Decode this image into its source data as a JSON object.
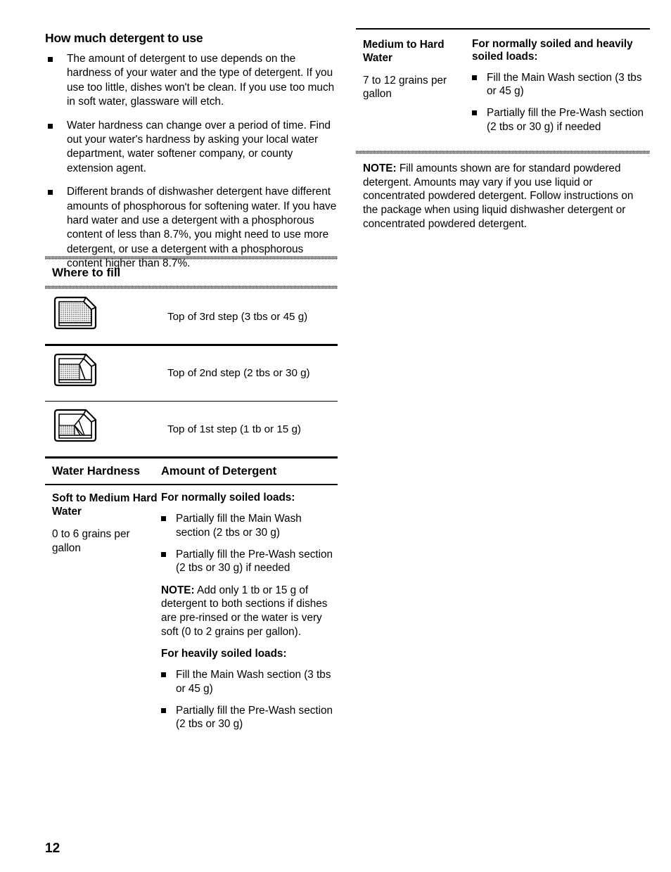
{
  "page": {
    "number": "12"
  },
  "left_column": {
    "heading": "How much detergent to use",
    "bullets": [
      "The amount of detergent to use depends on the hardness of your water and the type of detergent. If you use too little, dishes won't be clean. If you use too much in soft water, glassware will etch.",
      "Water hardness can change over a period of time. Find out your water's hardness by asking your local water department, water softener company, or county extension agent.",
      "Different brands of dishwasher detergent have different amounts of phosphorous for softening water. If you have hard water and use a detergent with a phosphorous content of less than 8.7%, you might need to use more detergent, or use a detergent with a phosphorous content higher than 8.7%."
    ]
  },
  "where_to_fill": {
    "heading": "Where to fill",
    "rows": [
      {
        "icon": "detergent-cup-full-icon",
        "label": "Top of 3rd step (3 tbs or 45 g)"
      },
      {
        "icon": "detergent-cup-two-thirds-icon",
        "label": "Top of 2nd step (2 tbs or 30 g)"
      },
      {
        "icon": "detergent-cup-one-third-icon",
        "label": "Top of 1st step (1 tb or 15 g)"
      }
    ]
  },
  "hardness_table": {
    "header": {
      "col1": "Water Hardness",
      "col2": "Amount of Detergent"
    },
    "soft_row": {
      "hardness_name": "Soft to Medium Hard Water",
      "hardness_range": "0 to 6 grains per gallon",
      "normal_heading": "For normally soiled loads:",
      "normal_bullets": [
        "Partially fill the Main Wash section (2 tbs or 30 g)",
        "Partially fill the Pre-Wash section (2 tbs or 30 g) if needed"
      ],
      "note_label": "NOTE:",
      "note_text": " Add only 1 tb or 15 g of detergent to both sections if dishes are pre-rinsed or the water is very soft (0 to 2 grains per gallon).",
      "heavy_heading": "For heavily soiled loads:",
      "heavy_bullets": [
        "Fill the Main Wash section (3 tbs or 45 g)",
        "Partially fill the Pre-Wash section (2 tbs or 30 g)"
      ]
    },
    "hard_row": {
      "hardness_name": "Medium to Hard Water",
      "hardness_range": "7 to 12 grains per gallon",
      "loads_heading": "For normally soiled and heavily soiled loads:",
      "bullets": [
        "Fill the Main Wash section (3 tbs or 45 g)",
        "Partially fill the Pre-Wash section (2 tbs or 30 g) if needed"
      ]
    }
  },
  "right_note": {
    "label": "NOTE:",
    "text": " Fill amounts shown are for standard powdered detergent. Amounts may vary if you use liquid or concentrated powdered detergent. Follow instructions on the package when using liquid dishwasher detergent or concentrated powdered detergent."
  }
}
